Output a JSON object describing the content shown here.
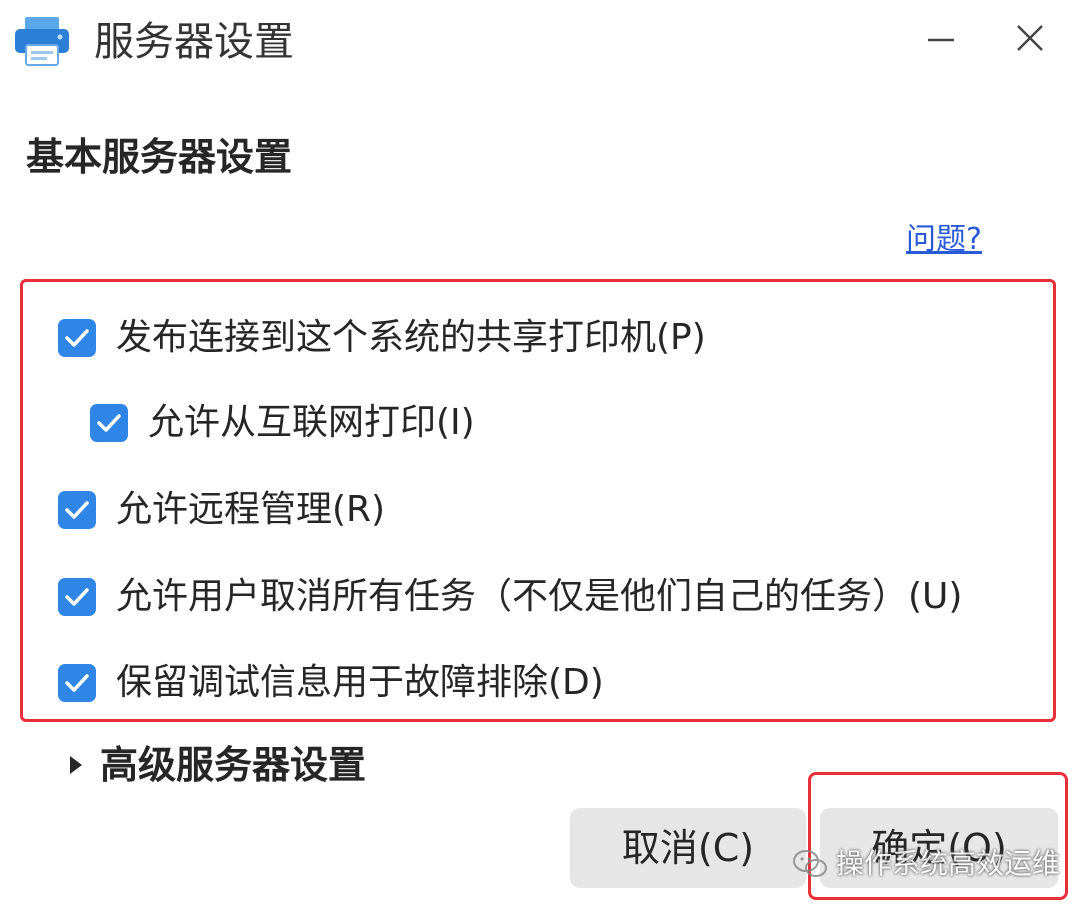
{
  "window": {
    "title": "服务器设置",
    "title_icon": "printer-icon",
    "controls": [
      "minimize-icon",
      "close-icon"
    ]
  },
  "section": {
    "title": "基本服务器设置",
    "help_link": "问题?"
  },
  "options": [
    {
      "label": "发布连接到这个系统的共享打印机(P)",
      "checked": true,
      "indent": false
    },
    {
      "label": "允许从互联网打印(I)",
      "checked": true,
      "indent": true
    },
    {
      "label": "允许远程管理(R)",
      "checked": true,
      "indent": false
    },
    {
      "label": "允许用户取消所有任务（不仅是他们自己的任务）(U)",
      "checked": true,
      "indent": false
    },
    {
      "label": "保留调试信息用于故障排除(D)",
      "checked": true,
      "indent": false
    }
  ],
  "advanced": {
    "label": "高级服务器设置",
    "expanded": false
  },
  "buttons": {
    "cancel": "取消(C)",
    "ok": "确定(O)"
  },
  "watermark": {
    "text": "操作系统高效运维",
    "icon": "wechat-icon"
  },
  "colors": {
    "checkbox": "#2f86e6",
    "highlight_border": "#e8303a",
    "link": "#2a5bd7",
    "button_bg": "#e6e6e6"
  }
}
